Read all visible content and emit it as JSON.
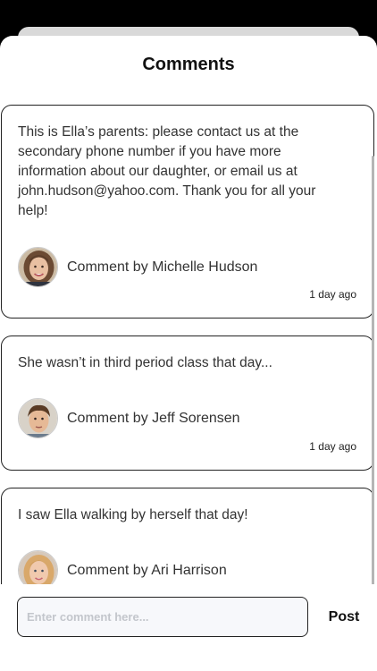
{
  "header": {
    "title": "Comments"
  },
  "comments": [
    {
      "text": "This is Ella’s parents: please contact us at the secondary phone number if you have more information about our daughter, or email us at john.hudson@yahoo.com. Thank you for all your help!",
      "author": "Comment by Michelle Hudson",
      "time": "1 day ago"
    },
    {
      "text": "She wasn’t in third period class that day...",
      "author": "Comment by Jeff Sorensen",
      "time": "1 day ago"
    },
    {
      "text": "I saw Ella walking by herself that day!",
      "author": "Comment by Ari Harrison",
      "time": ""
    }
  ],
  "composer": {
    "placeholder": "Enter comment here...",
    "post_label": "Post"
  }
}
